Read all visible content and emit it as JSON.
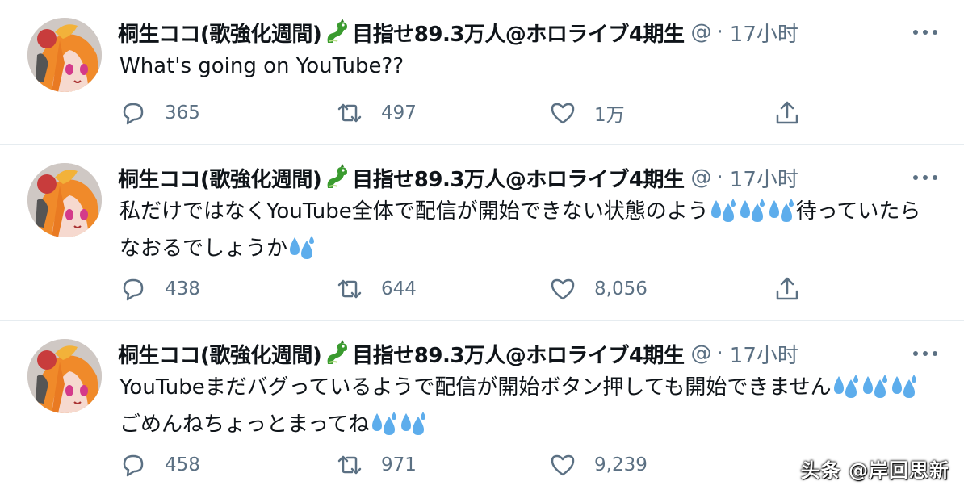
{
  "tweets": [
    {
      "author_name_part1": "桐生ココ(歌強化週間)",
      "author_name_part2": "目指せ89.3万人@ホロライブ4期生",
      "handle_truncated": "@",
      "separator": "·",
      "time": "17小时",
      "text_before_drops": "What's going on YouTube??",
      "drops_mid": 0,
      "text_after_drops": "",
      "drops_end": 0,
      "replies": "365",
      "retweets": "497",
      "likes": "1万"
    },
    {
      "author_name_part1": "桐生ココ(歌強化週間)",
      "author_name_part2": "目指せ89.3万人@ホロライブ4期生",
      "handle_truncated": "@",
      "separator": "·",
      "time": "17小时",
      "text_before_drops": "私だけではなくYouTube全体で配信が開始できない状態のよう",
      "drops_mid": 3,
      "text_after_drops": "待っていたらなおるでしょうか",
      "drops_end": 1,
      "replies": "438",
      "retweets": "644",
      "likes": "8,056"
    },
    {
      "author_name_part1": "桐生ココ(歌強化週間)",
      "author_name_part2": "目指せ89.3万人@ホロライブ4期生",
      "handle_truncated": "@",
      "separator": "·",
      "time": "17小时",
      "text_before_drops": "YouTubeまだバグっているようで配信が開始ボタン押しても開始できません",
      "drops_mid": 3,
      "text_after_drops": "ごめんねちょっとまってね",
      "drops_end": 2,
      "replies": "458",
      "retweets": "971",
      "likes": "9,239"
    }
  ],
  "icons": {
    "reply": "reply-icon",
    "retweet": "retweet-icon",
    "like": "heart-icon",
    "share": "share-icon",
    "more": "more-icon",
    "drop": "sweat-drops-emoji",
    "dragon": "dragon-emoji"
  },
  "colors": {
    "text": "#0f1419",
    "secondary": "#5b7083",
    "divider": "#e6ecf0",
    "drop_blue": "#5dadec",
    "dragon_green": "#3a9b2f"
  },
  "watermark": "头条 @岸回思新"
}
